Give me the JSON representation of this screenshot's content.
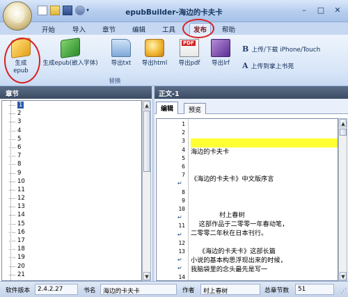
{
  "app": {
    "title": "epubBuilder-海边的卡夫卡",
    "window_controls": {
      "minimize": "–",
      "maximize": "□",
      "close": "✕"
    }
  },
  "menu": {
    "tabs": [
      {
        "label": "开始"
      },
      {
        "label": "导入"
      },
      {
        "label": "章节"
      },
      {
        "label": "编辑"
      },
      {
        "label": "工具"
      },
      {
        "label": "发布",
        "active": true
      },
      {
        "label": "帮助"
      }
    ]
  },
  "ribbon": {
    "buttons": [
      {
        "label": "生成\nepub",
        "icon": "book-yellow-icon"
      },
      {
        "label": "生成epub(嵌入字体)",
        "icon": "book-green-icon"
      },
      {
        "label": "导出txt",
        "icon": "folder-icon"
      },
      {
        "label": "导出html",
        "icon": "globe-icon"
      },
      {
        "label": "导出pdf",
        "icon": "pdf-icon"
      },
      {
        "label": "导出lrf",
        "icon": "lrf-book-icon"
      }
    ],
    "side_actions": [
      {
        "glyph": "B",
        "label": "上传/下载 iPhone/Touch"
      },
      {
        "glyph": "A",
        "label": "上传到掌上书苑"
      }
    ],
    "group_label": "替换"
  },
  "left_pane": {
    "header": "章节",
    "chapters": [
      "1",
      "2",
      "3",
      "4",
      "5",
      "6",
      "7",
      "8",
      "9",
      "10",
      "11",
      "12",
      "13",
      "14",
      "15",
      "16",
      "17",
      "18",
      "19",
      "20",
      "21"
    ],
    "selected_index": 0
  },
  "right_pane": {
    "header": "正文-1",
    "tabs": [
      {
        "label": "编辑",
        "active": true
      },
      {
        "label": "预览"
      }
    ],
    "gutter": [
      {
        "num": "1",
        "icon": ""
      },
      {
        "num": "2",
        "icon": ""
      },
      {
        "num": "3",
        "icon": ""
      },
      {
        "num": "4",
        "icon": ""
      },
      {
        "num": "5",
        "icon": ""
      },
      {
        "num": "6",
        "icon": ""
      },
      {
        "num": "7",
        "icon": ""
      },
      {
        "num": "",
        "icon": "wrap"
      },
      {
        "num": "8",
        "icon": ""
      },
      {
        "num": "9",
        "icon": ""
      },
      {
        "num": "10",
        "icon": ""
      },
      {
        "num": "",
        "icon": "wrap"
      },
      {
        "num": "11",
        "icon": ""
      },
      {
        "num": "",
        "icon": "wrap"
      },
      {
        "num": "12",
        "icon": ""
      },
      {
        "num": "13",
        "icon": ""
      },
      {
        "num": "",
        "icon": "wrap"
      },
      {
        "num": "",
        "icon": "wrap"
      },
      {
        "num": "14",
        "icon": ""
      }
    ],
    "lines": [
      {
        "text": "",
        "hl": false
      },
      {
        "text": "",
        "hl": false
      },
      {
        "text": "",
        "hl": true
      },
      {
        "text": "海边的卡夫卡",
        "hl": false
      },
      {
        "text": "",
        "hl": false
      },
      {
        "text": "",
        "hl": false
      },
      {
        "text": "《海边的卡夫卡》中文版序言",
        "hl": false
      },
      {
        "text": "",
        "hl": false
      },
      {
        "text": "",
        "hl": false
      },
      {
        "text": "",
        "hl": false
      },
      {
        "text": "              村上春树",
        "hl": false
      },
      {
        "text": "    这部作品于二零零一年春动笔，",
        "hl": false
      },
      {
        "text": "二零零二年秋在日本刊行。",
        "hl": false
      },
      {
        "text": "",
        "hl": false
      },
      {
        "text": "    《海边的卡夫卡》这部长篇",
        "hl": false
      },
      {
        "text": "小说的基本构思浮现出来的时候，",
        "hl": false
      },
      {
        "text": "我脑袋里的念头最先是写一",
        "hl": false
      },
      {
        "text": "",
        "hl": false
      }
    ]
  },
  "status": {
    "version_label": "软件版本",
    "version": "2.4.2.27",
    "book_label": "书名",
    "book": "海边的卡夫卡",
    "author_label": "作者",
    "author": "村上春树",
    "chapters_label": "总章节数",
    "chapters": "51"
  }
}
